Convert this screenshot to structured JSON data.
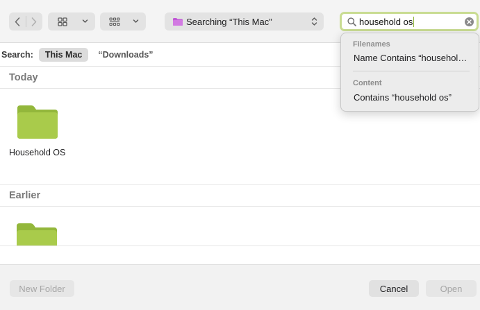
{
  "toolbar": {
    "location": {
      "label": "Searching “This Mac”",
      "folder_color": "#c158d6"
    },
    "search": {
      "value": "household os",
      "focus_ring": "#c9dc92"
    }
  },
  "scope": {
    "label": "Search:",
    "selected": "This Mac",
    "option": "“Downloads”"
  },
  "sections": {
    "today": {
      "title": "Today",
      "items": [
        {
          "name": "Household OS",
          "icon": "folder-icon",
          "color": "#a9cb4b"
        }
      ]
    },
    "earlier": {
      "title": "Earlier"
    }
  },
  "dropdown": {
    "filenames_header": "Filenames",
    "filenames_item": "Name Contains “household os”",
    "content_header": "Content",
    "content_item": "Contains “household os”"
  },
  "buttons": {
    "new_folder": "New Folder",
    "cancel": "Cancel",
    "open": "Open"
  }
}
